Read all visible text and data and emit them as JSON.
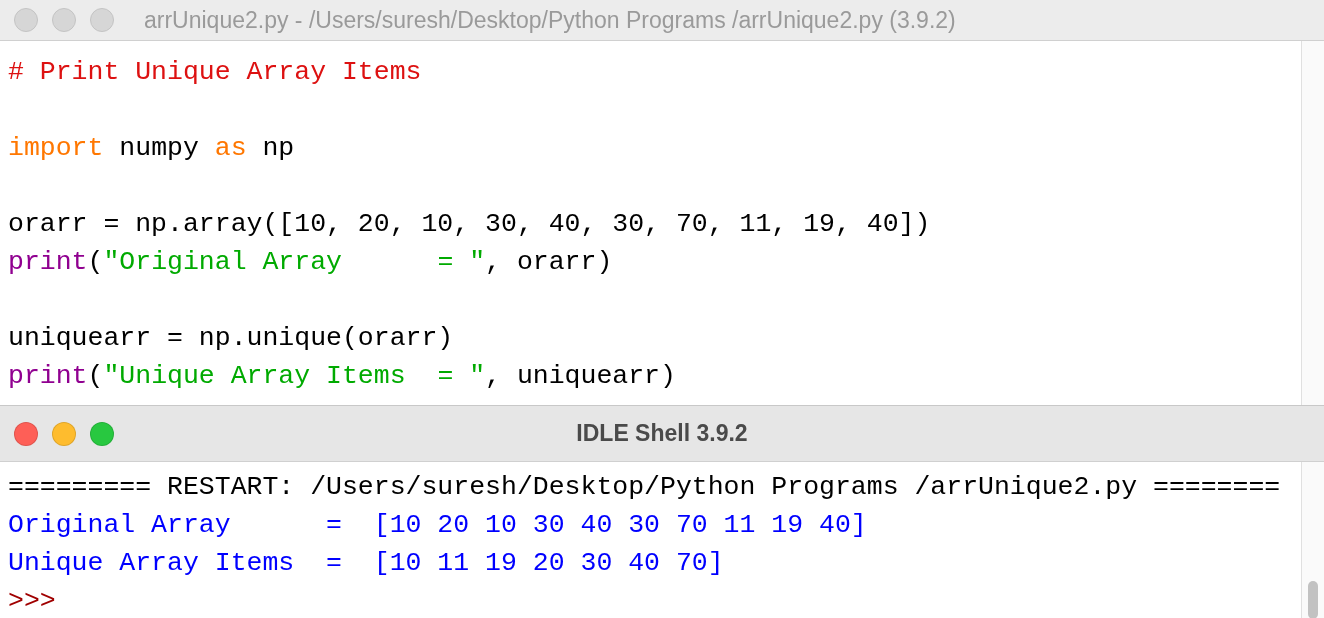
{
  "editor": {
    "title": "arrUnique2.py - /Users/suresh/Desktop/Python Programs /arrUnique2.py (3.9.2)",
    "active": false,
    "lines": [
      {
        "kind": "code",
        "tokens": [
          {
            "kind": "comment",
            "text": "# Print Unique Array Items"
          }
        ]
      },
      {
        "kind": "blank"
      },
      {
        "kind": "code",
        "tokens": [
          {
            "kind": "keyword",
            "text": "import"
          },
          {
            "kind": "plain",
            "text": " numpy "
          },
          {
            "kind": "keyword",
            "text": "as"
          },
          {
            "kind": "plain",
            "text": " np"
          }
        ]
      },
      {
        "kind": "blank"
      },
      {
        "kind": "code",
        "tokens": [
          {
            "kind": "plain",
            "text": "orarr = np.array([10, 20, 10, 30, 40, 30, 70, 11, 19, 40])"
          }
        ]
      },
      {
        "kind": "code",
        "tokens": [
          {
            "kind": "builtin",
            "text": "print"
          },
          {
            "kind": "plain",
            "text": "("
          },
          {
            "kind": "string",
            "text": "\"Original Array      = \""
          },
          {
            "kind": "plain",
            "text": ", orarr)"
          }
        ]
      },
      {
        "kind": "blank"
      },
      {
        "kind": "code",
        "tokens": [
          {
            "kind": "plain",
            "text": "uniquearr = np.unique(orarr)"
          }
        ]
      },
      {
        "kind": "code",
        "tokens": [
          {
            "kind": "builtin",
            "text": "print"
          },
          {
            "kind": "plain",
            "text": "("
          },
          {
            "kind": "string",
            "text": "\"Unique Array Items  = \""
          },
          {
            "kind": "plain",
            "text": ", uniquearr)"
          }
        ]
      }
    ]
  },
  "shell": {
    "title": "IDLE Shell 3.9.2",
    "active": true,
    "lines": [
      {
        "kind": "restart",
        "text": "========= RESTART: /Users/suresh/Desktop/Python Programs /arrUnique2.py ========"
      },
      {
        "kind": "stdout",
        "text": "Original Array      =  [10 20 10 30 40 30 70 11 19 40]"
      },
      {
        "kind": "stdout",
        "text": "Unique Array Items  =  [10 11 19 20 30 40 70]"
      },
      {
        "kind": "prompt",
        "text": ">>>"
      }
    ]
  }
}
